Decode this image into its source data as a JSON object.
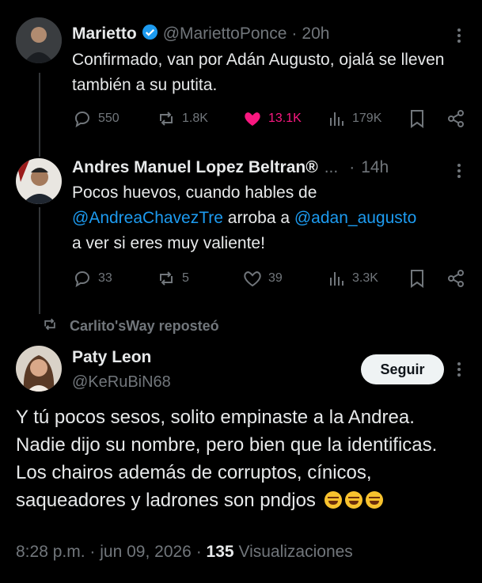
{
  "tweet1": {
    "name": "Marietto",
    "handle": "@MariettoPonce",
    "sep": "·",
    "time": "20h",
    "text": "Confirmado, van por Adán Augusto, ojalá se lleven también a su putita.",
    "replies": "550",
    "reposts": "1.8K",
    "likes": "13.1K",
    "views": "179K"
  },
  "tweet2": {
    "name": "Andres Manuel Lopez Beltran®",
    "ellipsis": "...",
    "sep": "·",
    "time": "14h",
    "text_1": "Pocos huevos, cuando hables de",
    "mention_1": "@AndreaChavezTre",
    "text_2": " arroba a ",
    "mention_2": "@adan_augusto",
    "text_3": "a ver si eres muy valiente!",
    "replies": "33",
    "reposts": "5",
    "likes": "39",
    "views": "3.3K"
  },
  "repost_context": {
    "label": "Carlito'sWay reposteó"
  },
  "tweet3": {
    "name": "Paty Leon",
    "handle": "@KeRuBiN68",
    "follow_label": "Seguir",
    "text": "Y tú pocos sesos, solito empinaste a la Andrea. Nadie dijo su nombre, pero bien que la identificas. Los chairos además de corruptos, cínicos, saqueadores y ladrones son pndjos",
    "emojis": [
      "rolling-on-floor-laughing",
      "rolling-on-floor-laughing",
      "rolling-on-floor-laughing"
    ],
    "time": "8:28 p.m.",
    "sep1": "·",
    "date": "jun 09, 2026",
    "sep2": "·",
    "views_count": "135",
    "views_label": "Visualizaciones"
  },
  "colors": {
    "background": "#000000",
    "text": "#e7e9ea",
    "muted": "#71767b",
    "link": "#1d9bf0",
    "like": "#f91880",
    "verified": "#1d9bf0"
  }
}
